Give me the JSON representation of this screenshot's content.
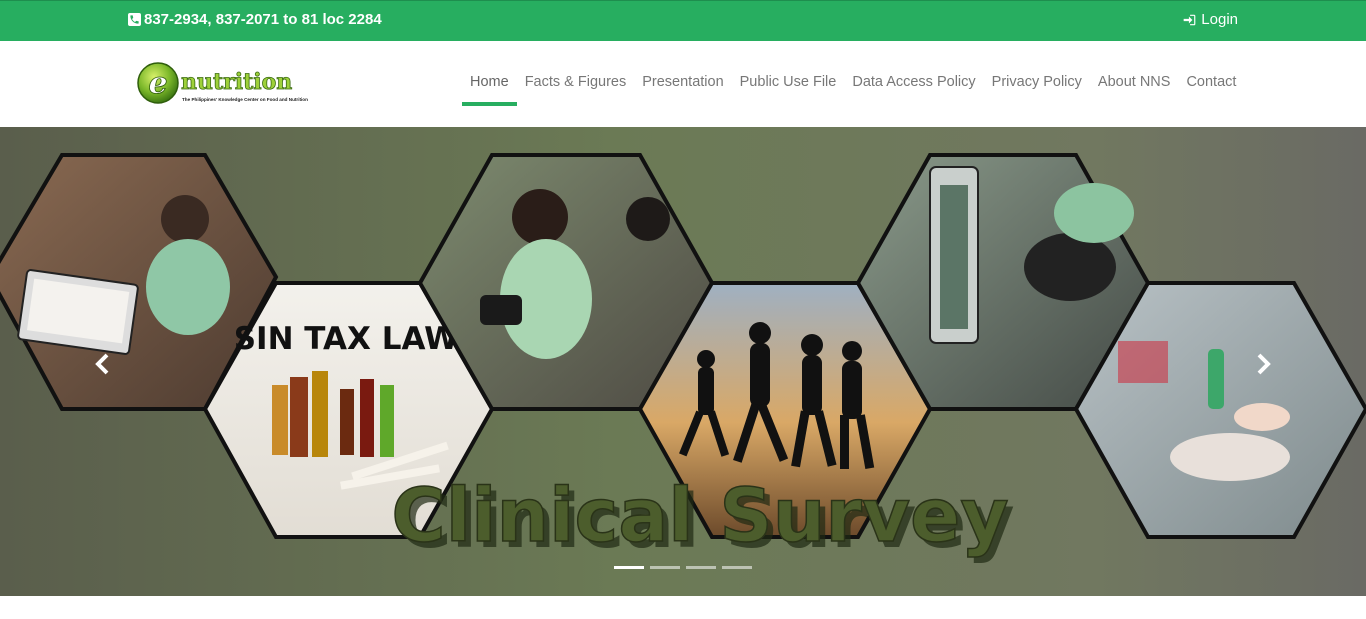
{
  "topbar": {
    "phone": "837-2934, 837-2071 to 81 loc 2284",
    "login_label": "Login",
    "background": "#27ae60"
  },
  "logo": {
    "word": "nutrition",
    "letter": "e",
    "tagline": "The Philippines' Knowledge Center on Food and Nutrition"
  },
  "nav": {
    "items": [
      {
        "label": "Home",
        "active": true
      },
      {
        "label": "Facts & Figures"
      },
      {
        "label": "Presentation"
      },
      {
        "label": "Public Use File"
      },
      {
        "label": "Data Access Policy"
      },
      {
        "label": "Privacy Policy"
      },
      {
        "label": "About NNS"
      },
      {
        "label": "Contact"
      }
    ]
  },
  "hero": {
    "slide_text": "Clinical Survey",
    "sign_text": "SIN TAX LAW",
    "slide_count": 4,
    "active_slide": 1
  }
}
